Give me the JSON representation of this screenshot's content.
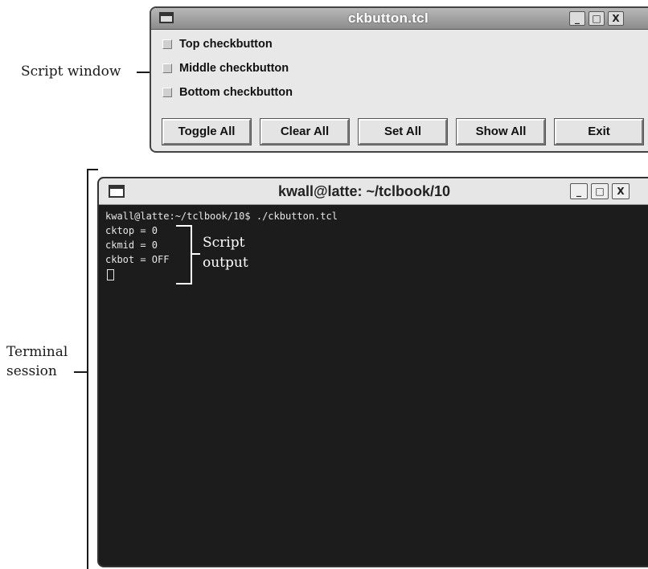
{
  "annotations": {
    "script_window": "Script window",
    "terminal_session_line1": "Terminal",
    "terminal_session_line2": "session",
    "script_output_line1": "Script",
    "script_output_line2": "output"
  },
  "script_window": {
    "title": "ckbutton.tcl",
    "checkbuttons": [
      {
        "label": "Top checkbutton",
        "checked": false
      },
      {
        "label": "Middle checkbutton",
        "checked": false
      },
      {
        "label": "Bottom checkbutton",
        "checked": false
      }
    ],
    "buttons": [
      "Toggle All",
      "Clear All",
      "Set All",
      "Show All",
      "Exit"
    ],
    "controls": {
      "minimize": "_",
      "maximize": "□",
      "close": "X"
    }
  },
  "terminal": {
    "title": "kwall@latte: ~/tclbook/10",
    "lines": [
      "kwall@latte:~/tclbook/10$ ./ckbutton.tcl",
      "cktop = 0",
      "ckmid = 0",
      "ckbot = OFF"
    ],
    "controls": {
      "minimize": "_",
      "maximize": "□",
      "close": "X"
    }
  }
}
